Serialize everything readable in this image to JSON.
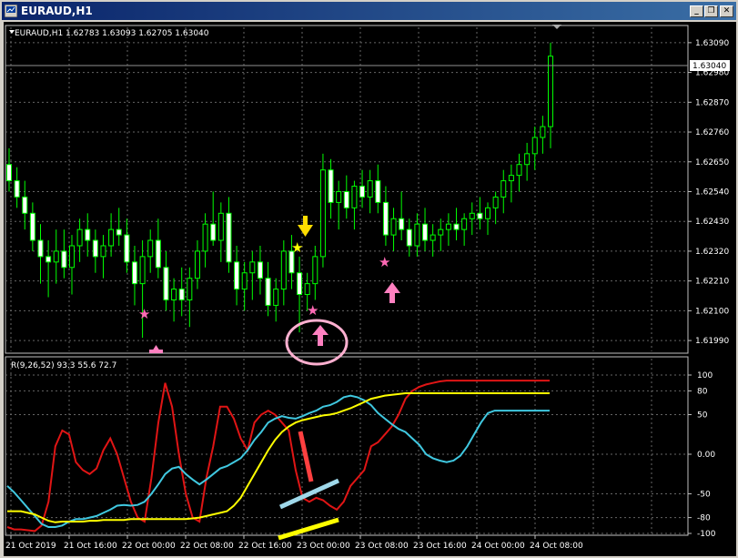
{
  "window": {
    "title": "EURAUD,H1",
    "buttons": [
      "minimize",
      "restore",
      "close"
    ]
  },
  "main_header": {
    "symbol_info": "EURAUD,H1  1.62783 1.63093 1.62705 1.63040"
  },
  "price_axis": {
    "labels": [
      "1.63090",
      "1.62980",
      "1.62870",
      "1.62760",
      "1.62650",
      "1.62540",
      "1.62430",
      "1.62320",
      "1.62210",
      "1.62100",
      "1.61990"
    ],
    "current_price": "1.63040"
  },
  "indicator": {
    "header": "R(9,26,52) 93.3 55.6 72.7",
    "labels": [
      "100",
      "80",
      "50",
      "0.00",
      "-50",
      "-80",
      "-100"
    ]
  },
  "time_axis": {
    "labels": [
      "21 Oct 2019",
      "21 Oct 16:00",
      "22 Oct 00:00",
      "22 Oct 08:00",
      "22 Oct 16:00",
      "23 Oct 00:00",
      "23 Oct 08:00",
      "23 Oct 16:00",
      "24 Oct 00:00",
      "24 Oct 08:00"
    ]
  },
  "colors": {
    "bull": "#00ff00",
    "bear": "#00ff00",
    "red_line": "#e01515",
    "cyan_line": "#40c8e0",
    "yellow_line": "#ffff00",
    "star_pink": "#ff69b4",
    "star_yellow": "#ffff00",
    "arrow_pink": "#ff80c0",
    "arrow_yellow": "#ffdd00"
  },
  "chart_data": [
    {
      "type": "candlestick",
      "title": "EURAUD,H1",
      "ylim": [
        1.6195,
        1.6314
      ],
      "candles": [
        {
          "o": 1.6264,
          "h": 1.627,
          "l": 1.6254,
          "c": 1.6258
        },
        {
          "o": 1.6258,
          "h": 1.6263,
          "l": 1.6248,
          "c": 1.6252
        },
        {
          "o": 1.6252,
          "h": 1.6258,
          "l": 1.624,
          "c": 1.6246
        },
        {
          "o": 1.6246,
          "h": 1.625,
          "l": 1.6232,
          "c": 1.6236
        },
        {
          "o": 1.6236,
          "h": 1.6242,
          "l": 1.622,
          "c": 1.623
        },
        {
          "o": 1.623,
          "h": 1.6236,
          "l": 1.6215,
          "c": 1.6228
        },
        {
          "o": 1.6228,
          "h": 1.624,
          "l": 1.622,
          "c": 1.6232
        },
        {
          "o": 1.6232,
          "h": 1.624,
          "l": 1.6222,
          "c": 1.6226
        },
        {
          "o": 1.6226,
          "h": 1.6238,
          "l": 1.6216,
          "c": 1.6234
        },
        {
          "o": 1.6234,
          "h": 1.6244,
          "l": 1.6228,
          "c": 1.624
        },
        {
          "o": 1.624,
          "h": 1.6246,
          "l": 1.623,
          "c": 1.6236
        },
        {
          "o": 1.6236,
          "h": 1.624,
          "l": 1.6224,
          "c": 1.623
        },
        {
          "o": 1.623,
          "h": 1.6238,
          "l": 1.6222,
          "c": 1.6234
        },
        {
          "o": 1.6234,
          "h": 1.6246,
          "l": 1.623,
          "c": 1.624
        },
        {
          "o": 1.624,
          "h": 1.6248,
          "l": 1.6234,
          "c": 1.6238
        },
        {
          "o": 1.6238,
          "h": 1.6244,
          "l": 1.6224,
          "c": 1.6228
        },
        {
          "o": 1.6228,
          "h": 1.6234,
          "l": 1.6212,
          "c": 1.622
        },
        {
          "o": 1.622,
          "h": 1.6236,
          "l": 1.62,
          "c": 1.623
        },
        {
          "o": 1.623,
          "h": 1.624,
          "l": 1.6224,
          "c": 1.6236
        },
        {
          "o": 1.6236,
          "h": 1.6244,
          "l": 1.6222,
          "c": 1.6226
        },
        {
          "o": 1.6226,
          "h": 1.6232,
          "l": 1.621,
          "c": 1.6214
        },
        {
          "o": 1.6214,
          "h": 1.6222,
          "l": 1.6206,
          "c": 1.6218
        },
        {
          "o": 1.6218,
          "h": 1.6226,
          "l": 1.6208,
          "c": 1.6214
        },
        {
          "o": 1.6214,
          "h": 1.6226,
          "l": 1.6204,
          "c": 1.6222
        },
        {
          "o": 1.6222,
          "h": 1.6236,
          "l": 1.6218,
          "c": 1.6232
        },
        {
          "o": 1.6232,
          "h": 1.6246,
          "l": 1.6226,
          "c": 1.6242
        },
        {
          "o": 1.6242,
          "h": 1.6254,
          "l": 1.6234,
          "c": 1.6236
        },
        {
          "o": 1.6236,
          "h": 1.625,
          "l": 1.6228,
          "c": 1.6246
        },
        {
          "o": 1.6246,
          "h": 1.6252,
          "l": 1.6224,
          "c": 1.6228
        },
        {
          "o": 1.6228,
          "h": 1.6234,
          "l": 1.6212,
          "c": 1.6218
        },
        {
          "o": 1.6218,
          "h": 1.6228,
          "l": 1.621,
          "c": 1.6224
        },
        {
          "o": 1.6224,
          "h": 1.6232,
          "l": 1.6214,
          "c": 1.6228
        },
        {
          "o": 1.6228,
          "h": 1.6234,
          "l": 1.6216,
          "c": 1.6222
        },
        {
          "o": 1.6222,
          "h": 1.6228,
          "l": 1.6208,
          "c": 1.6212
        },
        {
          "o": 1.6212,
          "h": 1.6222,
          "l": 1.6206,
          "c": 1.6218
        },
        {
          "o": 1.6218,
          "h": 1.6236,
          "l": 1.6212,
          "c": 1.6232
        },
        {
          "o": 1.6232,
          "h": 1.6238,
          "l": 1.6218,
          "c": 1.6224
        },
        {
          "o": 1.6224,
          "h": 1.623,
          "l": 1.6202,
          "c": 1.6216
        },
        {
          "o": 1.6216,
          "h": 1.6224,
          "l": 1.621,
          "c": 1.622
        },
        {
          "o": 1.622,
          "h": 1.6234,
          "l": 1.6214,
          "c": 1.623
        },
        {
          "o": 1.623,
          "h": 1.6268,
          "l": 1.6226,
          "c": 1.6262
        },
        {
          "o": 1.6262,
          "h": 1.6266,
          "l": 1.6244,
          "c": 1.625
        },
        {
          "o": 1.625,
          "h": 1.6258,
          "l": 1.624,
          "c": 1.6254
        },
        {
          "o": 1.6254,
          "h": 1.626,
          "l": 1.6244,
          "c": 1.6248
        },
        {
          "o": 1.6248,
          "h": 1.6258,
          "l": 1.624,
          "c": 1.6256
        },
        {
          "o": 1.6256,
          "h": 1.6262,
          "l": 1.6248,
          "c": 1.6252
        },
        {
          "o": 1.6252,
          "h": 1.6262,
          "l": 1.6246,
          "c": 1.6258
        },
        {
          "o": 1.6258,
          "h": 1.6264,
          "l": 1.6246,
          "c": 1.625
        },
        {
          "o": 1.625,
          "h": 1.6256,
          "l": 1.6234,
          "c": 1.6238
        },
        {
          "o": 1.6238,
          "h": 1.6248,
          "l": 1.6232,
          "c": 1.6244
        },
        {
          "o": 1.6244,
          "h": 1.6254,
          "l": 1.6236,
          "c": 1.624
        },
        {
          "o": 1.624,
          "h": 1.6244,
          "l": 1.623,
          "c": 1.6234
        },
        {
          "o": 1.6234,
          "h": 1.6246,
          "l": 1.623,
          "c": 1.6242
        },
        {
          "o": 1.6242,
          "h": 1.6248,
          "l": 1.6232,
          "c": 1.6236
        },
        {
          "o": 1.6236,
          "h": 1.6242,
          "l": 1.623,
          "c": 1.6238
        },
        {
          "o": 1.6238,
          "h": 1.6244,
          "l": 1.6232,
          "c": 1.624
        },
        {
          "o": 1.624,
          "h": 1.6246,
          "l": 1.6234,
          "c": 1.6242
        },
        {
          "o": 1.6242,
          "h": 1.6248,
          "l": 1.6236,
          "c": 1.624
        },
        {
          "o": 1.624,
          "h": 1.6246,
          "l": 1.6234,
          "c": 1.6244
        },
        {
          "o": 1.6244,
          "h": 1.625,
          "l": 1.6238,
          "c": 1.6246
        },
        {
          "o": 1.6246,
          "h": 1.6252,
          "l": 1.624,
          "c": 1.6244
        },
        {
          "o": 1.6244,
          "h": 1.625,
          "l": 1.6238,
          "c": 1.6248
        },
        {
          "o": 1.6248,
          "h": 1.6254,
          "l": 1.6242,
          "c": 1.6252
        },
        {
          "o": 1.6252,
          "h": 1.6262,
          "l": 1.6246,
          "c": 1.6258
        },
        {
          "o": 1.6258,
          "h": 1.6264,
          "l": 1.625,
          "c": 1.626
        },
        {
          "o": 1.626,
          "h": 1.6268,
          "l": 1.6254,
          "c": 1.6264
        },
        {
          "o": 1.6264,
          "h": 1.6272,
          "l": 1.6258,
          "c": 1.6268
        },
        {
          "o": 1.6268,
          "h": 1.6278,
          "l": 1.6262,
          "c": 1.6274
        },
        {
          "o": 1.6274,
          "h": 1.6282,
          "l": 1.6268,
          "c": 1.6278
        },
        {
          "o": 1.6278,
          "h": 1.6309,
          "l": 1.627,
          "c": 1.6304
        }
      ]
    },
    {
      "type": "line",
      "title": "R(9,26,52)",
      "ylim": [
        -100,
        100
      ],
      "x_count": 80,
      "series": [
        {
          "name": "R9",
          "color": "#e01515",
          "values": [
            -92,
            -95,
            -95,
            -96,
            -97,
            -90,
            -60,
            10,
            30,
            25,
            -10,
            -20,
            -25,
            -18,
            5,
            20,
            0,
            -30,
            -60,
            -80,
            -85,
            -30,
            40,
            90,
            60,
            0,
            -50,
            -80,
            -85,
            -30,
            10,
            60,
            60,
            45,
            20,
            5,
            40,
            50,
            55,
            50,
            40,
            30,
            -20,
            -55,
            -60,
            -55,
            -58,
            -65,
            -70,
            -60,
            -40,
            -30,
            -20,
            10,
            15,
            25,
            35,
            50,
            70,
            80,
            85,
            88,
            90,
            92,
            93,
            93,
            93,
            93,
            93,
            93,
            93,
            93,
            93,
            93,
            93,
            93,
            93,
            93,
            93,
            93
          ]
        },
        {
          "name": "R26",
          "color": "#40c8e0",
          "values": [
            -40,
            -48,
            -58,
            -68,
            -78,
            -88,
            -92,
            -92,
            -90,
            -85,
            -82,
            -82,
            -80,
            -78,
            -74,
            -70,
            -65,
            -64,
            -65,
            -64,
            -60,
            -50,
            -38,
            -25,
            -18,
            -16,
            -25,
            -32,
            -38,
            -32,
            -25,
            -18,
            -15,
            -10,
            -5,
            5,
            18,
            28,
            40,
            45,
            48,
            46,
            45,
            48,
            52,
            55,
            60,
            62,
            66,
            72,
            74,
            72,
            68,
            62,
            52,
            45,
            38,
            32,
            28,
            20,
            12,
            0,
            -5,
            -8,
            -10,
            -8,
            -2,
            10,
            25,
            40,
            52,
            55,
            55,
            55,
            55,
            55,
            55,
            55,
            55,
            55
          ]
        },
        {
          "name": "R52",
          "color": "#ffff00",
          "values": [
            -72,
            -72,
            -72,
            -74,
            -76,
            -80,
            -84,
            -86,
            -85,
            -85,
            -85,
            -85,
            -84,
            -84,
            -83,
            -83,
            -83,
            -83,
            -82,
            -82,
            -82,
            -82,
            -82,
            -82,
            -82,
            -82,
            -82,
            -81,
            -80,
            -78,
            -76,
            -74,
            -72,
            -65,
            -55,
            -40,
            -25,
            -10,
            5,
            18,
            28,
            35,
            40,
            43,
            45,
            47,
            49,
            50,
            52,
            55,
            58,
            62,
            66,
            70,
            72,
            74,
            75,
            76,
            77,
            77,
            77,
            77,
            77,
            77,
            77,
            77,
            77,
            77,
            77,
            77,
            77,
            77,
            77,
            77,
            77,
            77,
            77,
            77,
            77,
            77
          ]
        }
      ]
    }
  ]
}
